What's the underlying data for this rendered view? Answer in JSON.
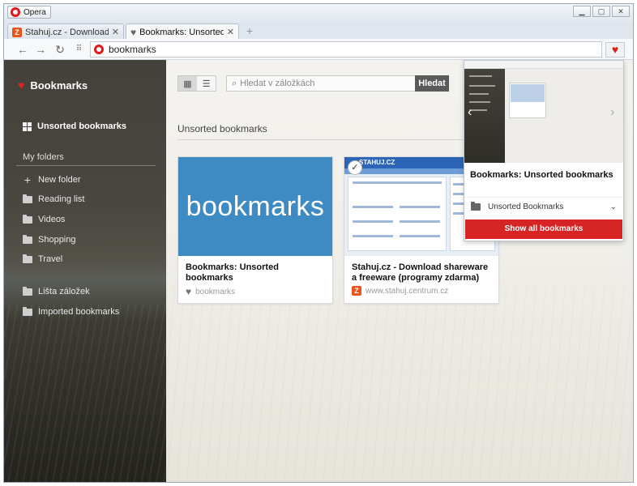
{
  "titlebar": {
    "app_button": "Opera",
    "controls": [
      "▁",
      "▢",
      "✕"
    ]
  },
  "tabs": [
    {
      "label": "Stahuj.cz - Download shareware",
      "close": "✕",
      "icon": "stahuj-favicon"
    },
    {
      "label": "Bookmarks: Unsorted bookmarks",
      "close": "✕",
      "icon": "heart-icon"
    }
  ],
  "navbar": {
    "back": "←",
    "forward": "→",
    "reload": "↻",
    "address": "bookmarks",
    "bookmark_heart": "♥"
  },
  "sidebar": {
    "title": "Bookmarks",
    "unsorted": "Unsorted bookmarks",
    "my_folders": "My folders",
    "new_folder": "New folder",
    "folders": [
      "Reading list",
      "Videos",
      "Shopping",
      "Travel"
    ],
    "lista": "Lišta záložek",
    "imported": "Imported bookmarks"
  },
  "toolbar": {
    "search_placeholder": "Hledat v záložkách",
    "search_button": "Hledat"
  },
  "main": {
    "section_title": "Unsorted bookmarks"
  },
  "cards": [
    {
      "thumb_text": "bookmarks",
      "title": "Bookmarks: Unsorted bookmarks",
      "url": "bookmarks"
    },
    {
      "thumb_text": "STAHUJ.CZ",
      "title": "Stahuj.cz - Download shareware a freeware (programy zdarma)",
      "url": "www.stahuj.centrum.cz"
    }
  ],
  "popup": {
    "title": "Bookmarks: Unsorted bookmarks",
    "folder": "Unsorted Bookmarks",
    "show_all": "Show all bookmarks"
  },
  "colors": {
    "accent_red": "#d62424",
    "card_blue": "#3d8bc2"
  }
}
